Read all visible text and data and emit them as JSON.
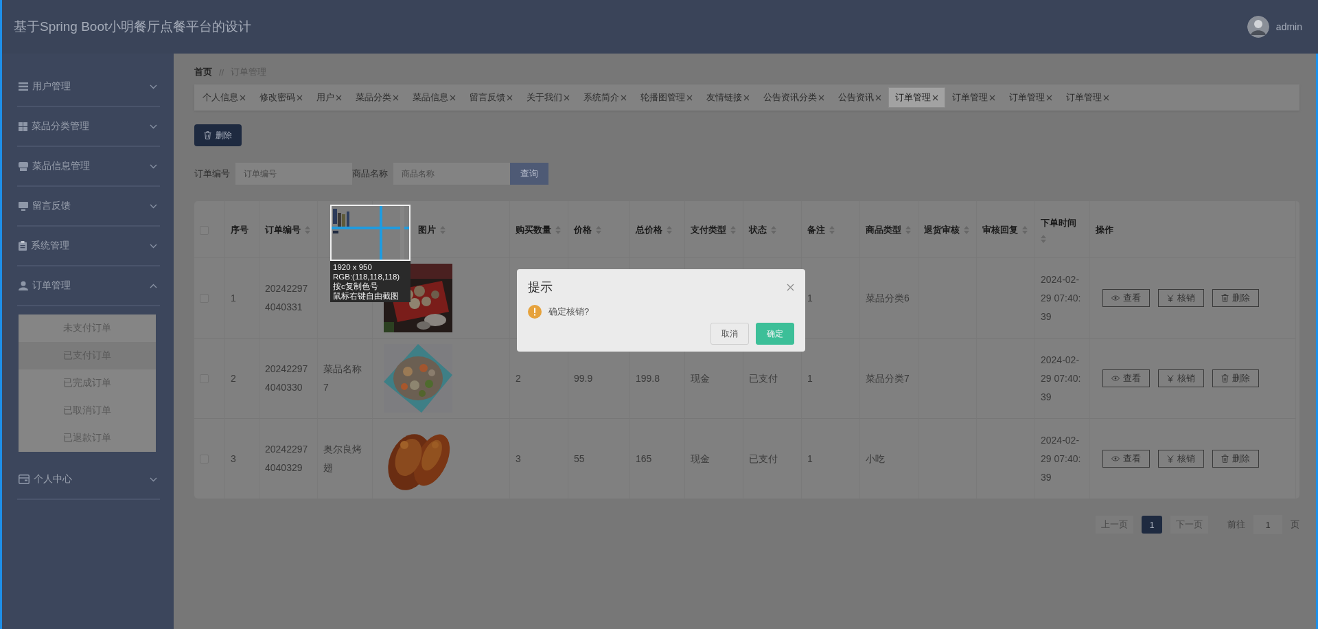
{
  "app_title": "基于Spring Boot小明餐厅点餐平台的设计",
  "user": {
    "name": "admin"
  },
  "sidebar": {
    "items": [
      {
        "label": "用户管理",
        "expanded": false
      },
      {
        "label": "菜品分类管理",
        "expanded": false
      },
      {
        "label": "菜品信息管理",
        "expanded": false
      },
      {
        "label": "留言反馈",
        "expanded": false
      },
      {
        "label": "系统管理",
        "expanded": false
      },
      {
        "label": "订单管理",
        "expanded": true,
        "children": [
          {
            "label": "未支付订单",
            "selected": false
          },
          {
            "label": "已支付订单",
            "selected": true
          },
          {
            "label": "已完成订单",
            "selected": false
          },
          {
            "label": "已取消订单",
            "selected": false
          },
          {
            "label": "已退款订单",
            "selected": false
          }
        ]
      },
      {
        "label": "个人中心",
        "expanded": false
      }
    ]
  },
  "breadcrumb": {
    "items": [
      "首页",
      "订单管理"
    ],
    "separator": "//"
  },
  "tabs": [
    {
      "label": "个人信息",
      "selected": false
    },
    {
      "label": "修改密码",
      "selected": false
    },
    {
      "label": "用户",
      "selected": false
    },
    {
      "label": "菜品分类",
      "selected": false
    },
    {
      "label": "菜品信息",
      "selected": false
    },
    {
      "label": "留言反馈",
      "selected": false
    },
    {
      "label": "关于我们",
      "selected": false
    },
    {
      "label": "系统简介",
      "selected": false
    },
    {
      "label": "轮播图管理",
      "selected": false
    },
    {
      "label": "友情链接",
      "selected": false
    },
    {
      "label": "公告资讯分类",
      "selected": false
    },
    {
      "label": "公告资讯",
      "selected": false
    },
    {
      "label": "订单管理",
      "selected": true
    },
    {
      "label": "订单管理",
      "selected": false
    },
    {
      "label": "订单管理",
      "selected": false
    },
    {
      "label": "订单管理",
      "selected": false
    }
  ],
  "toolbar": {
    "delete_button": "删除"
  },
  "search": {
    "fields": [
      {
        "label": "订单编号",
        "placeholder": "订单编号"
      },
      {
        "label": "商品名称",
        "placeholder": "商品名称"
      }
    ],
    "button": "查询"
  },
  "table": {
    "header_checked": false,
    "columns": [
      {
        "label": "序号",
        "sortable": false
      },
      {
        "label": "订单编号",
        "sortable": true
      },
      {
        "sortable": false
      },
      {
        "label": "图片",
        "sortable": true
      },
      {
        "label": "购买数量",
        "sortable": true
      },
      {
        "label": "价格",
        "sortable": true
      },
      {
        "label": "总价格",
        "sortable": true
      },
      {
        "label": "支付类型",
        "sortable": true
      },
      {
        "label": "状态",
        "sortable": true
      },
      {
        "label": "备注",
        "sortable": true
      },
      {
        "label": "商品类型",
        "sortable": true
      },
      {
        "label": "退货审核",
        "sortable": true
      },
      {
        "label": "审核回复",
        "sortable": true
      },
      {
        "label": "下单时间",
        "sortable": true
      },
      {
        "label": "操作",
        "sortable": false
      }
    ],
    "rows": [
      {
        "checked": false,
        "index": "1",
        "order_no": "202422974040331",
        "remark": "1",
        "category": "菜品分类6",
        "time": "2024-02-29 07:40:39",
        "actions": [
          {
            "kind": "view",
            "label": "查看"
          },
          {
            "kind": "verify",
            "label": "核销"
          },
          {
            "kind": "delete",
            "label": "删除"
          }
        ]
      },
      {
        "checked": false,
        "index": "2",
        "order_no": "202422974040330",
        "name": "菜品名称7",
        "qty": "2",
        "price": "99.9",
        "total": "199.8",
        "pay_type": "现金",
        "status": "已支付",
        "remark": "1",
        "category": "菜品分类7",
        "time": "2024-02-29 07:40:39",
        "actions": [
          {
            "kind": "view",
            "label": "查看"
          },
          {
            "kind": "verify",
            "label": "核销"
          },
          {
            "kind": "delete",
            "label": "删除"
          }
        ]
      },
      {
        "checked": false,
        "index": "3",
        "order_no": "202422974040329",
        "name": "奥尔良烤翅",
        "qty": "3",
        "price": "55",
        "total": "165",
        "pay_type": "现金",
        "status": "已支付",
        "remark": "1",
        "category": "小吃",
        "time": "2024-02-29 07:40:39",
        "actions": [
          {
            "kind": "view",
            "label": "查看"
          },
          {
            "kind": "verify",
            "label": "核销"
          },
          {
            "kind": "delete",
            "label": "删除"
          }
        ]
      }
    ]
  },
  "pagination": {
    "prev": {
      "label": "上一页",
      "disabled": true
    },
    "pages": [
      {
        "label": "1",
        "selected": true
      }
    ],
    "next": {
      "label": "下一页",
      "disabled": true
    },
    "goto_label": "前往",
    "goto_value": "1",
    "goto_suffix": "页"
  },
  "capture_magnifier": {
    "size": "1920 x 950",
    "color_reading": "RGB:(118,118,118)",
    "hints": [
      "按c复制色号",
      "鼠标右键自由截图"
    ]
  },
  "dialog": {
    "title": "提示",
    "message": "确定核销?",
    "buttons": [
      {
        "label": "取消",
        "kind": "default"
      },
      {
        "label": "确定",
        "kind": "primary"
      }
    ]
  }
}
